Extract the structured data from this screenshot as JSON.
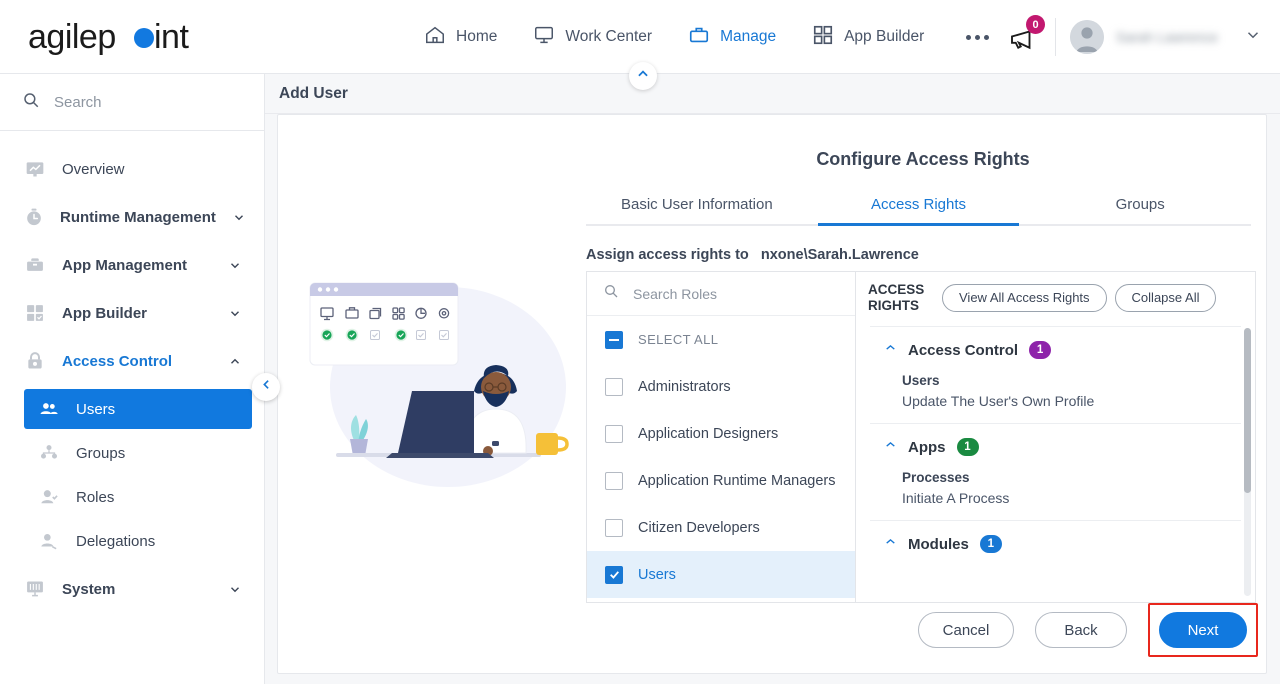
{
  "header": {
    "logo_text": "agilepoint",
    "nav": [
      {
        "label": "Home",
        "icon": "home-icon",
        "active": false
      },
      {
        "label": "Work Center",
        "icon": "monitor-icon",
        "active": false
      },
      {
        "label": "Manage",
        "icon": "briefcase-icon",
        "active": true
      },
      {
        "label": "App Builder",
        "icon": "grid-icon",
        "active": false
      }
    ],
    "more_label": "more-options",
    "announcement_count": "0",
    "user_name": "Sarah Lawrence"
  },
  "sidebar": {
    "search_placeholder": "Search",
    "items": [
      {
        "label": "Overview",
        "icon": "chart-monitor-icon",
        "expandable": false,
        "open": false
      },
      {
        "label": "Runtime Management",
        "icon": "clock-icon",
        "expandable": true,
        "open": false
      },
      {
        "label": "App Management",
        "icon": "toolbox-icon",
        "expandable": true,
        "open": false
      },
      {
        "label": "App Builder",
        "icon": "grid-icon",
        "expandable": true,
        "open": false
      },
      {
        "label": "Access Control",
        "icon": "lock-icon",
        "expandable": true,
        "open": true
      }
    ],
    "sub_items": [
      {
        "label": "Users",
        "icon": "users-icon",
        "selected": true
      },
      {
        "label": "Groups",
        "icon": "group-icon",
        "selected": false
      },
      {
        "label": "Roles",
        "icon": "role-icon",
        "selected": false
      },
      {
        "label": "Delegations",
        "icon": "delegation-icon",
        "selected": false
      }
    ],
    "trailing": [
      {
        "label": "System",
        "icon": "system-icon",
        "expandable": true,
        "open": false
      }
    ]
  },
  "page": {
    "title": "Add User",
    "form_title": "Configure Access Rights",
    "tabs": [
      {
        "label": "Basic User Information",
        "active": false
      },
      {
        "label": "Access Rights",
        "active": true
      },
      {
        "label": "Groups",
        "active": false
      }
    ],
    "assign_label": "Assign access rights to",
    "assign_user": "nxone\\Sarah.Lawrence"
  },
  "roles": {
    "search_placeholder": "Search Roles",
    "select_all_label": "SELECT ALL",
    "select_all_state": "indeterminate",
    "items": [
      {
        "label": "Administrators",
        "checked": false,
        "selected": false
      },
      {
        "label": "Application Designers",
        "checked": false,
        "selected": false
      },
      {
        "label": "Application Runtime Managers",
        "checked": false,
        "selected": false
      },
      {
        "label": "Citizen Developers",
        "checked": false,
        "selected": false
      },
      {
        "label": "Users",
        "checked": true,
        "selected": true
      }
    ]
  },
  "access_rights": {
    "title": "ACCESS RIGHTS",
    "view_all_label": "View All Access Rights",
    "collapse_all_label": "Collapse All",
    "groups": [
      {
        "name": "Access Control",
        "count": "1",
        "badge_color": "#8e24aa",
        "expanded": true,
        "subheading": "Users",
        "entries": [
          "Update The User's Own Profile"
        ]
      },
      {
        "name": "Apps",
        "count": "1",
        "badge_color": "#1a8a41",
        "expanded": true,
        "subheading": "Processes",
        "entries": [
          "Initiate A Process"
        ]
      },
      {
        "name": "Modules",
        "count": "1",
        "badge_color": "#1878d4",
        "expanded": true,
        "subheading": "",
        "entries": []
      }
    ]
  },
  "footer": {
    "cancel_label": "Cancel",
    "back_label": "Back",
    "next_label": "Next",
    "next_highlight_color": "#e8271d"
  },
  "colors": {
    "accent": "#1878d4",
    "selected_row": "#1179df",
    "badge_pink": "#c2186f"
  }
}
